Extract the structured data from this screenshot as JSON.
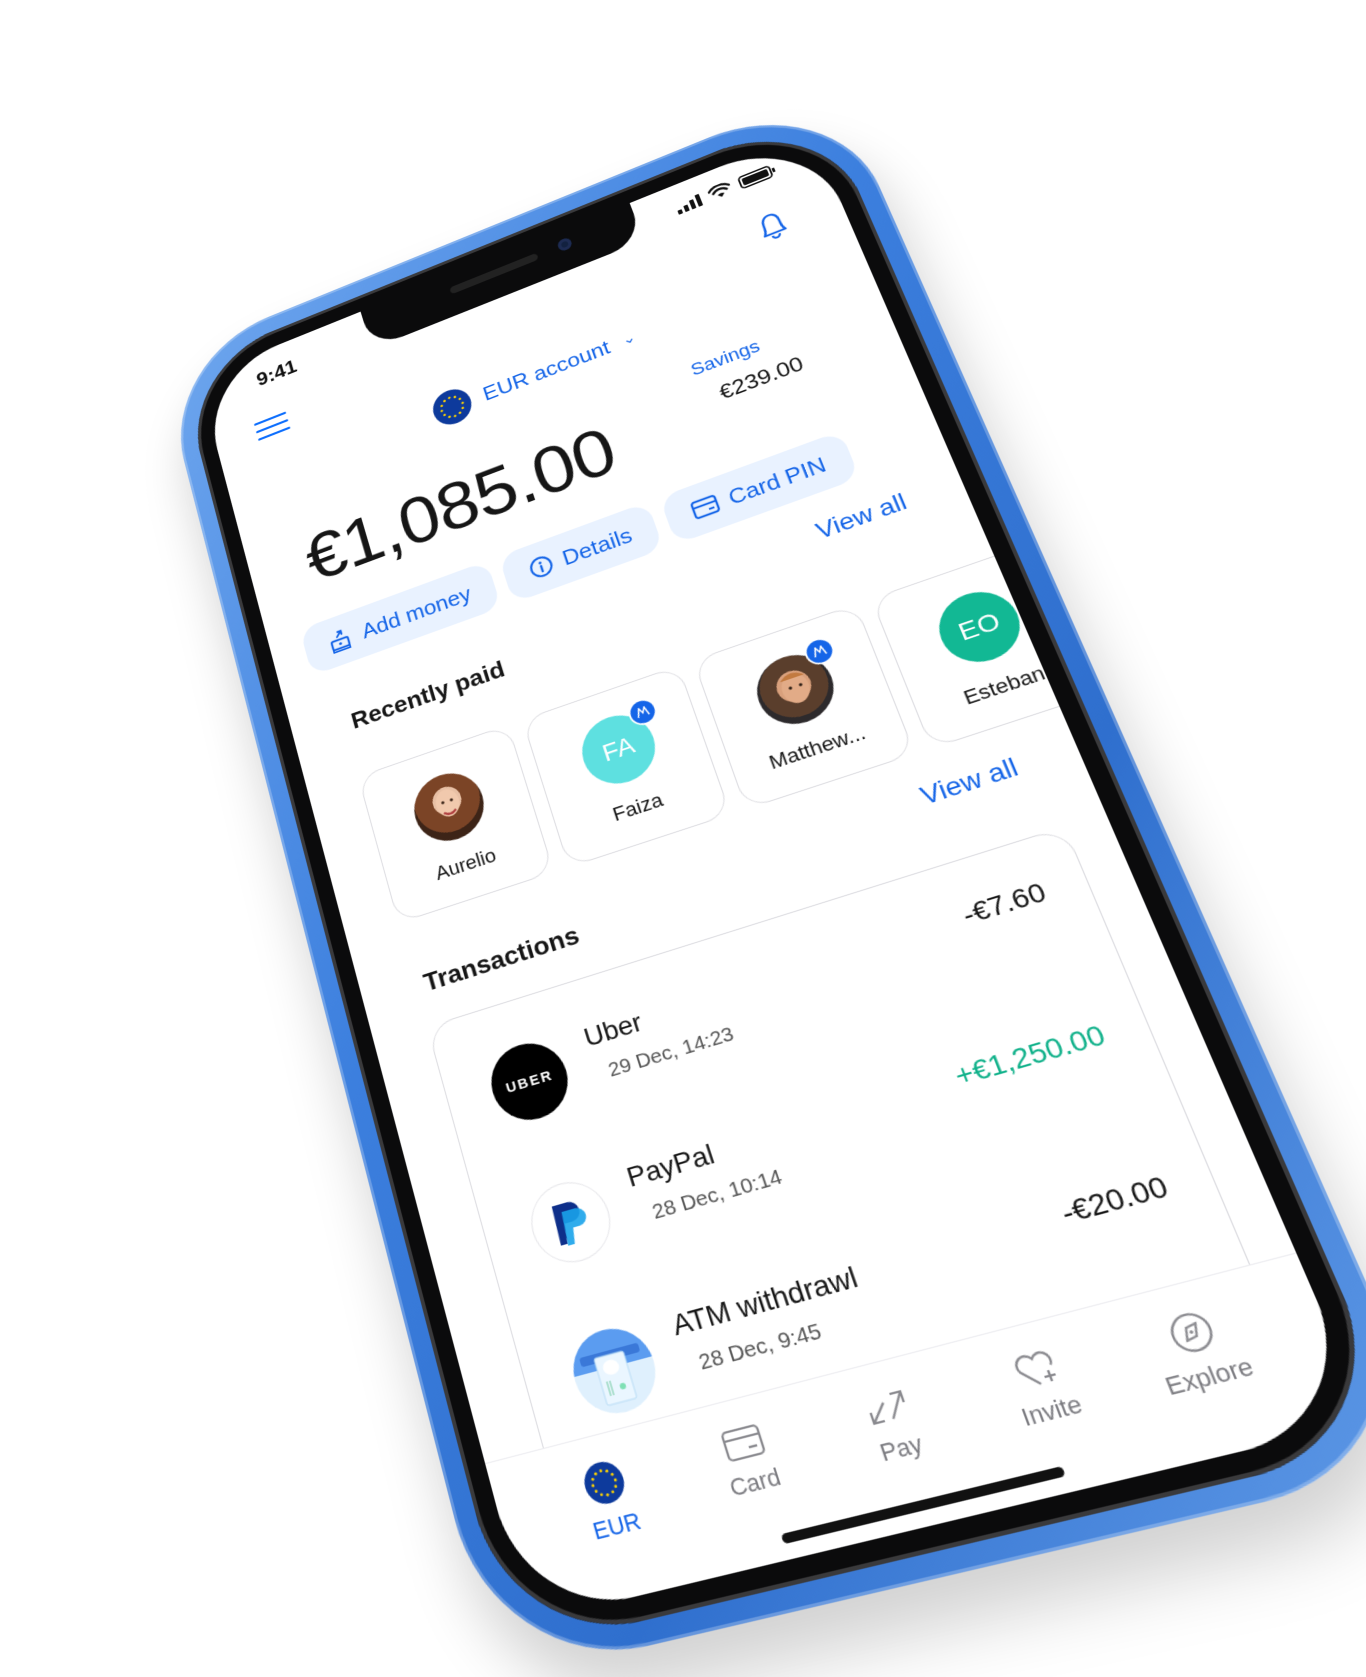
{
  "status_bar": {
    "time": "9:41"
  },
  "header": {
    "menu_icon": "hamburger-menu-icon",
    "notifications_icon": "bell-icon",
    "account_selector": {
      "label": "EUR account",
      "flag_icon": "eu-flag-icon",
      "chevron_icon": "chevron-down-icon"
    }
  },
  "balance": {
    "main": "€1,085.00",
    "savings_label": "Savings",
    "savings_value": "€239.00"
  },
  "actions": [
    {
      "label": "Add money",
      "icon": "add-money-icon"
    },
    {
      "label": "Details",
      "icon": "info-icon"
    },
    {
      "label": "Card PIN",
      "icon": "card-icon"
    }
  ],
  "recently_paid": {
    "title": "Recently paid",
    "view_all": "View all",
    "contacts": [
      {
        "name": "Aurelio",
        "initials": "",
        "avatar": "photo",
        "verified": false
      },
      {
        "name": "Faiza",
        "initials": "FA",
        "avatar_color": "#5ee0e0",
        "verified": true
      },
      {
        "name": "Matthew...",
        "initials": "",
        "avatar": "photo",
        "verified": true
      },
      {
        "name": "Esteban",
        "initials": "EO",
        "avatar_color": "#12b894",
        "verified": false
      }
    ]
  },
  "transactions": {
    "title": "Transactions",
    "view_all": "View all",
    "items": [
      {
        "name": "Uber",
        "date": "29 Dec, 14:23",
        "amount": "-€7.60",
        "direction": "out",
        "icon": "uber-logo",
        "logo_text": "UBER"
      },
      {
        "name": "PayPal",
        "date": "28 Dec, 10:14",
        "amount": "+€1,250.00",
        "direction": "in",
        "icon": "paypal-logo"
      },
      {
        "name": "ATM withdrawl",
        "date": "28 Dec, 9:45",
        "amount": "-€20.00",
        "direction": "out",
        "icon": "atm-icon"
      }
    ]
  },
  "bottom_nav": [
    {
      "label": "EUR",
      "icon": "eu-flag-icon",
      "active": true
    },
    {
      "label": "Card",
      "icon": "card-icon",
      "active": false
    },
    {
      "label": "Pay",
      "icon": "transfer-arrows-icon",
      "active": false
    },
    {
      "label": "Invite",
      "icon": "heart-plus-icon",
      "active": false
    },
    {
      "label": "Explore",
      "icon": "compass-icon",
      "active": false
    }
  ],
  "colors": {
    "accent": "#1565e8",
    "chip_bg": "#e9f2ff",
    "positive": "#10b18a",
    "frame_blue": "#3c7fde",
    "text": "#161616"
  }
}
